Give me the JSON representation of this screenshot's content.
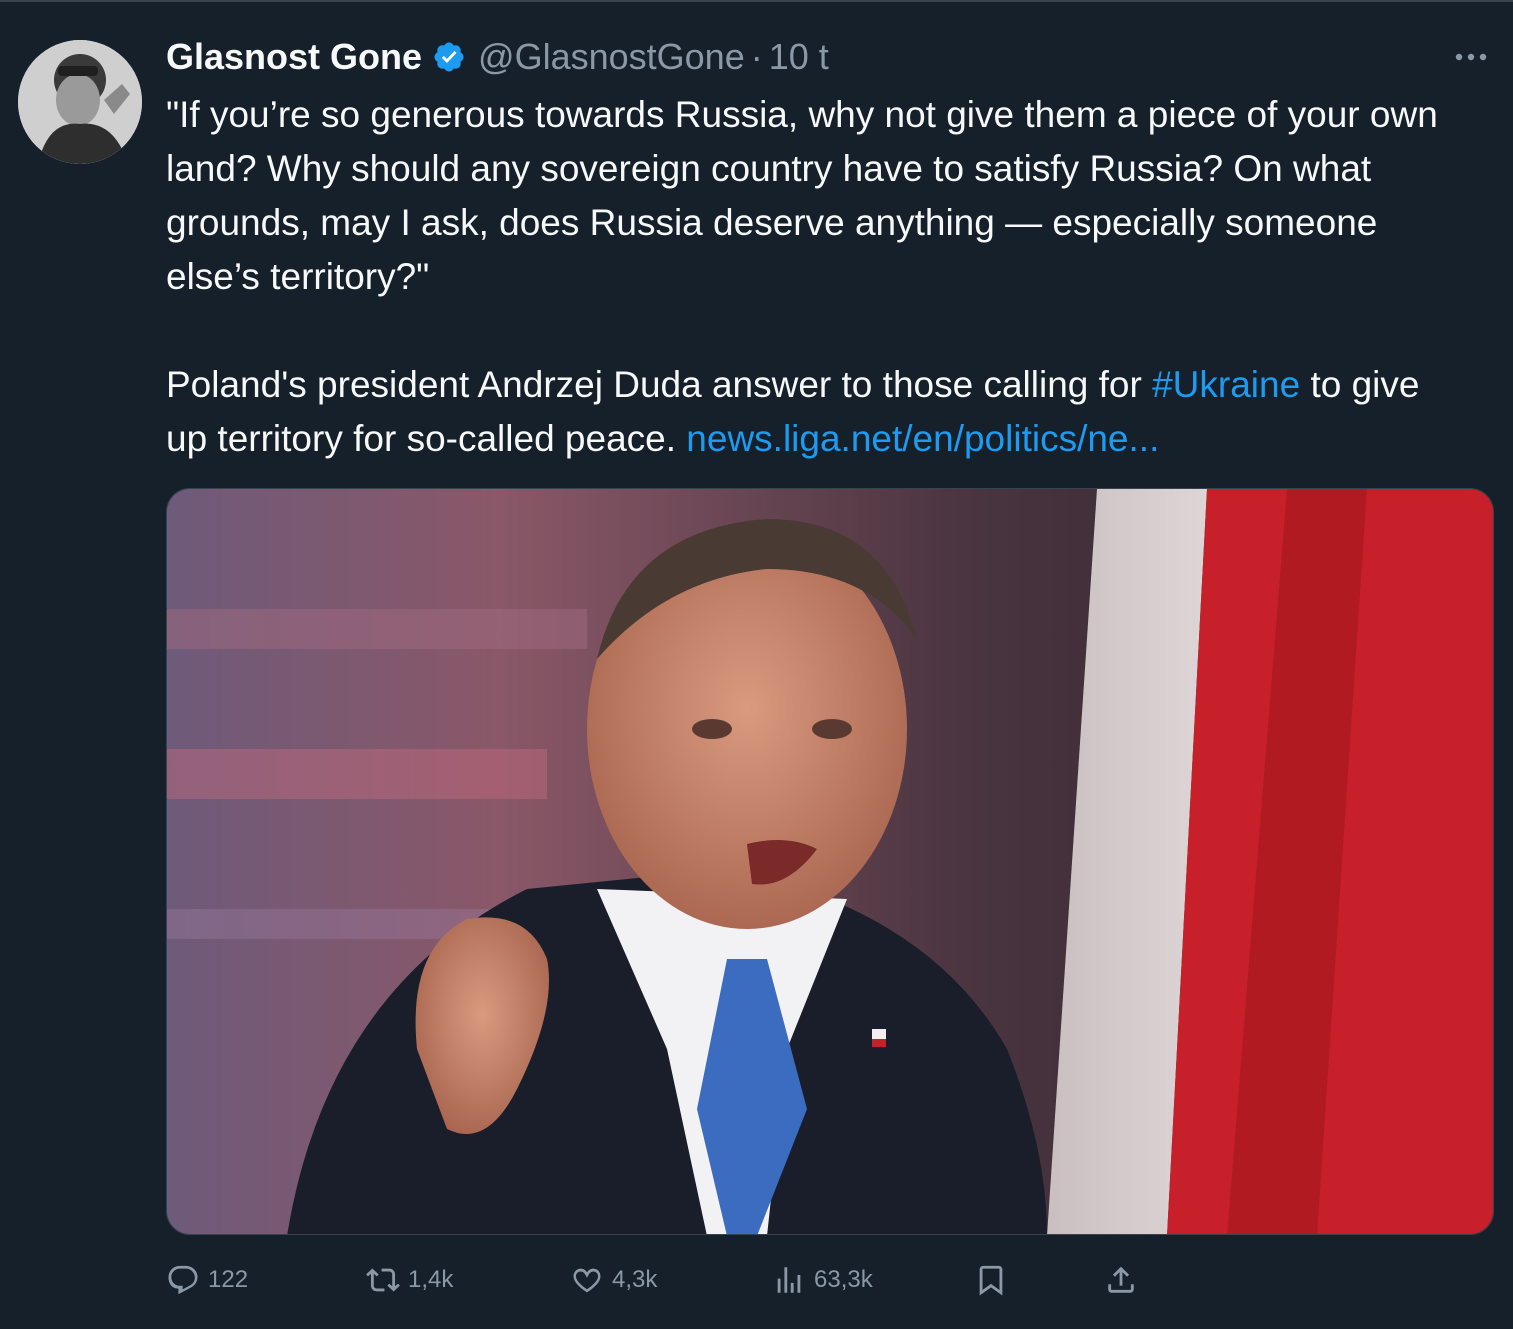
{
  "tweet": {
    "author_name": "Glasnost Gone",
    "handle": "@GlasnostGone",
    "separator": "·",
    "time": "10 t",
    "text_part1": "\"If you’re so generous towards Russia, why not give them a piece of your own land? Why should any sovereign country have to satisfy Russia? On what grounds, may I ask, does Russia deserve anything — especially someone else’s territory?\"",
    "text_part2_before": "Poland's president Andrzej Duda answer to those calling for ",
    "hashtag": "#Ukraine",
    "text_part2_middle": " to give up territory for so-called peace. ",
    "link_text": "news.liga.net/en/politics/ne..."
  },
  "actions": {
    "replies": "122",
    "retweets": "1,4k",
    "likes": "4,3k",
    "views": "63,3k"
  },
  "icons": {
    "verified": "verified-badge-icon",
    "more": "more-icon",
    "reply": "reply-icon",
    "retweet": "retweet-icon",
    "like": "heart-icon",
    "views": "views-icon",
    "bookmark": "bookmark-icon",
    "share": "share-icon"
  },
  "colors": {
    "background": "#15202b",
    "link": "#1d9bf0",
    "secondary_text": "#8b98a5",
    "primary_text": "#f7f9f9"
  }
}
